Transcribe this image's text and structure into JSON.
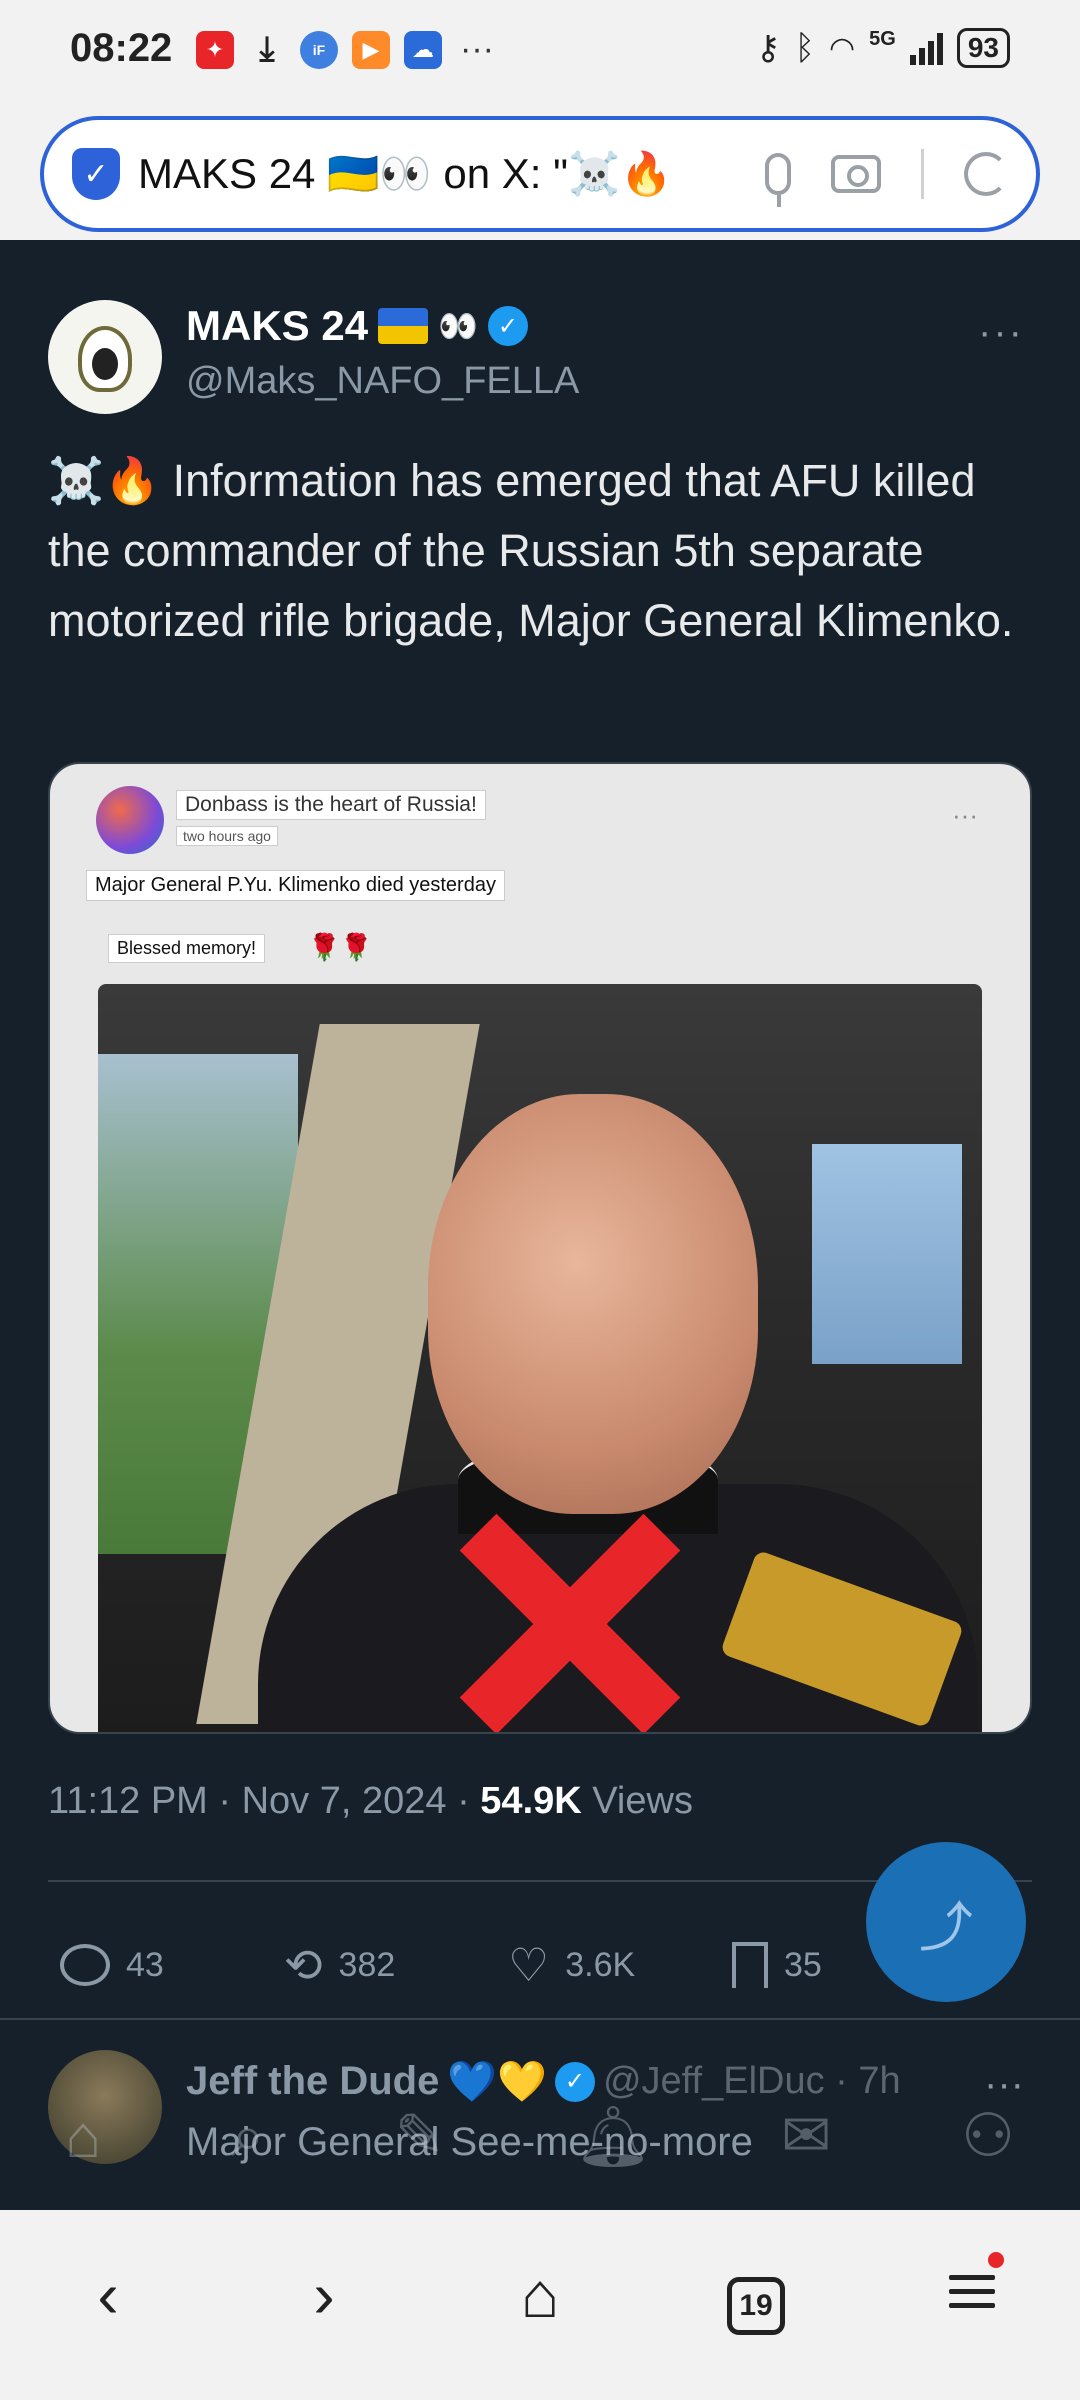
{
  "status_bar": {
    "time": "08:22",
    "battery": "93",
    "network": "5G",
    "more": "···"
  },
  "browser": {
    "url_text": "MAKS 24 🇺🇦👀 on X: \"☠️🔥",
    "shield_icon": "shield-check-icon"
  },
  "tweet": {
    "author_name": "MAKS 24",
    "author_emoji": "👀",
    "handle": "@Maks_NAFO_FELLA",
    "more": "···",
    "text": "☠️🔥 Information has emerged that AFU killed the commander of the Russian 5th separate motorized rifle brigade, Major General Klimenko.",
    "media": {
      "inner_title": "Donbass is the heart of Russia!",
      "inner_time": "two hours ago",
      "inner_caption": "Major General P.Yu. Klimenko died yesterday",
      "inner_memory": "Blessed memory!",
      "inner_roses": "🌹🌹",
      "inner_more": "···"
    },
    "timestamp": "11:12 PM · Nov 7, 2024 · ",
    "views_count": "54.9K",
    "views_label": " Views",
    "actions": {
      "replies": "43",
      "reposts": "382",
      "likes": "3.6K",
      "bookmarks": "35"
    }
  },
  "reply": {
    "name": "Jeff the Dude",
    "hearts": "💙💛",
    "handle": "@Jeff_ElDuc · 7h",
    "text": "Major General See-me-no-more",
    "more": "···"
  },
  "bottom_nav": {
    "tab_count": "19"
  },
  "colors": {
    "background": "#15202b",
    "accent": "#1d9bf0",
    "url_border": "#2e62d9"
  }
}
